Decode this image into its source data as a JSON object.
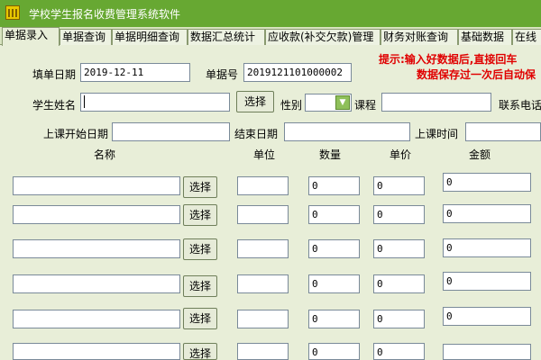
{
  "window": {
    "title": "学校学生报名收费管理系统软件"
  },
  "tabs": [
    "单据录入",
    "单据查询",
    "单据明细查询",
    "数据汇总统计",
    "应收款(补交欠款)管理",
    "财务对账查询",
    "基础数据",
    "在线"
  ],
  "form": {
    "date_label": "填单日期",
    "date_value": "2019-12-11",
    "number_label": "单据号",
    "number_value": "2019121101000002",
    "student_label": "学生姓名",
    "student_value": "",
    "select_label": "选择",
    "gender_label": "性别",
    "gender_value": "",
    "course_label": "课程",
    "course_value": "",
    "phone_label": "联系电话",
    "start_label": "上课开始日期",
    "start_value": "",
    "end_label": "结束日期",
    "end_value": "",
    "time_label": "上课时间",
    "time_value": ""
  },
  "hint": {
    "line1": "提示:输入好数据后,直接回车",
    "line2": "数据保存过一次后自动保"
  },
  "table": {
    "headers": {
      "name": "名称",
      "unit": "单位",
      "qty": "数量",
      "price": "单价",
      "amount": "金额"
    },
    "select_label": "选择",
    "rows": [
      {
        "name": "",
        "unit": "",
        "qty": "0",
        "price": "0",
        "amount": "0"
      },
      {
        "name": "",
        "unit": "",
        "qty": "0",
        "price": "0",
        "amount": "0"
      },
      {
        "name": "",
        "unit": "",
        "qty": "0",
        "price": "0",
        "amount": "0"
      },
      {
        "name": "",
        "unit": "",
        "qty": "0",
        "price": "0",
        "amount": "0"
      },
      {
        "name": "",
        "unit": "",
        "qty": "0",
        "price": "0",
        "amount": "0"
      },
      {
        "name": "",
        "unit": "",
        "qty": "0",
        "price": "0",
        "amount": ""
      }
    ]
  },
  "colors": {
    "titlebar": "#67a832",
    "hint": "#e00000",
    "background": "#e8eed8"
  }
}
